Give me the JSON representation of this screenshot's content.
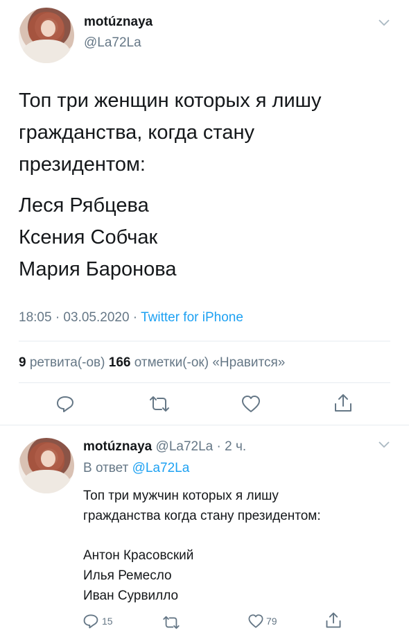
{
  "main_tweet": {
    "display_name": "motúznaya",
    "handle": "@La72La",
    "text_lines": [
      "Топ три женщин которых я лишу",
      "гражданства, когда стану",
      "президентом:"
    ],
    "list_lines": [
      "Леся Рябцева",
      "Ксения Собчак",
      "Мария Баронова"
    ],
    "time": "18:05 · 03.05.2020 · ",
    "client": "Twitter for iPhone",
    "retweets_count": "9",
    "retweets_label": " ретвита(-ов) ",
    "likes_count": "166",
    "likes_label": " отметки(-ок) «Нравится»"
  },
  "reply_tweet": {
    "display_name": "motúznaya",
    "handle_time": " @La72La · 2 ч.",
    "reply_prefix": "В ответ ",
    "reply_handle": "@La72La",
    "text_lines": [
      "Топ три мужчин которых я лишу",
      "гражданства когда стану президентом:"
    ],
    "list_lines": [
      "Антон Красовский",
      "Илья Ремесло",
      "Иван Сурвилло"
    ],
    "reply_count": "15",
    "like_count": "79"
  },
  "colors": {
    "accent": "#1da1f2",
    "muted": "#657786",
    "divider": "#e6ecf0"
  },
  "icons": [
    "reply-icon",
    "retweet-icon",
    "like-icon",
    "share-icon",
    "chevron-down-icon"
  ]
}
